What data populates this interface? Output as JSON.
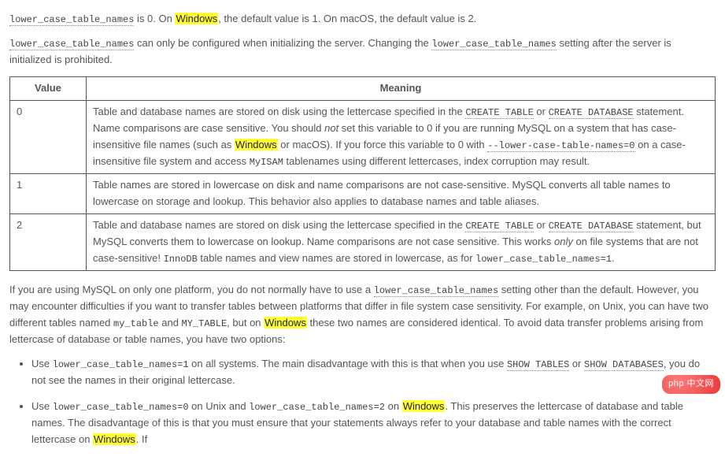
{
  "intro": {
    "p1_a": "lower_case_table_names",
    "p1_b": " is 0. On ",
    "p1_hl": "Windows",
    "p1_c": ", the default value is 1. On macOS, the default value is 2.",
    "p2_a": "lower_case_table_names",
    "p2_b": " can only be configured when initializing the server. Changing the ",
    "p2_c": "lower_case_table_names",
    "p2_d": " setting after the server is initialized is prohibited."
  },
  "table": {
    "headers": {
      "value": "Value",
      "meaning": "Meaning"
    },
    "rows": [
      {
        "value": "0",
        "t1": "Table and database names are stored on disk using the lettercase specified in the ",
        "c1": "CREATE TABLE",
        "t2": " or ",
        "c2": "CREATE DATABASE",
        "t3": " statement. Name comparisons are case sensitive. You should ",
        "em1": "not",
        "t4": " set this variable to 0 if you are running MySQL on a system that has case-insensitive file names (such as ",
        "hl1": "Windows",
        "t5": " or macOS). If you force this variable to 0 with ",
        "c3": "--lower-case-table-names=0",
        "t6": " on a case-insensitive file system and access ",
        "c4": "MyISAM",
        "t7": " tablenames using different lettercases, index corruption may result."
      },
      {
        "value": "1",
        "t1": "Table names are stored in lowercase on disk and name comparisons are not case-sensitive. MySQL converts all table names to lowercase on storage and lookup. This behavior also applies to database names and table aliases."
      },
      {
        "value": "2",
        "t1": "Table and database names are stored on disk using the lettercase specified in the ",
        "c1": "CREATE TABLE",
        "t2": " or ",
        "c2": "CREATE DATABASE",
        "t3": " statement, but MySQL converts them to lowercase on lookup. Name comparisons are not case sensitive. This works ",
        "em1": "only",
        "t4": " on file systems that are not case-sensitive! ",
        "c3": "InnoDB",
        "t5": " table names and view names are stored in lowercase, as for ",
        "c4": "lower_case_table_names=1",
        "t6": "."
      }
    ]
  },
  "after": {
    "p1_a": "If you are using MySQL on only one platform, you do not normally have to use a ",
    "p1_code1": "lower_case_table_names",
    "p1_b": " setting other than the default. However, you may encounter difficulties if you want to transfer tables between platforms that differ in file system case sensitivity. For example, on Unix, you can have two different tables named ",
    "p1_code2": "my_table",
    "p1_c": " and ",
    "p1_code3": "MY_TABLE",
    "p1_d": ", but on ",
    "p1_hl": "Windows",
    "p1_e": " these two names are considered identical. To avoid data transfer problems arising from lettercase of database or table names, you have two options:"
  },
  "list": {
    "i1_a": "Use ",
    "i1_code1": "lower_case_table_names=1",
    "i1_b": " on all systems. The main disadvantage with this is that when you use ",
    "i1_code2": "SHOW TABLES",
    "i1_c": " or ",
    "i1_code3": "SHOW DATABASES",
    "i1_d": ", you do not see the names in their original lettercase.",
    "i2_a": "Use ",
    "i2_code1": "lower_case_table_names=0",
    "i2_b": " on Unix and ",
    "i2_code2": "lower_case_table_names=2",
    "i2_c": " on ",
    "i2_hl1": "Windows",
    "i2_d": ". This preserves the lettercase of database and table names. The disadvantage of this is that you must ensure that your statements always refer to your database and table names with the correct lettercase on ",
    "i2_hl2": "Windows",
    "i2_e": ". If"
  },
  "badge": "php 中文网"
}
